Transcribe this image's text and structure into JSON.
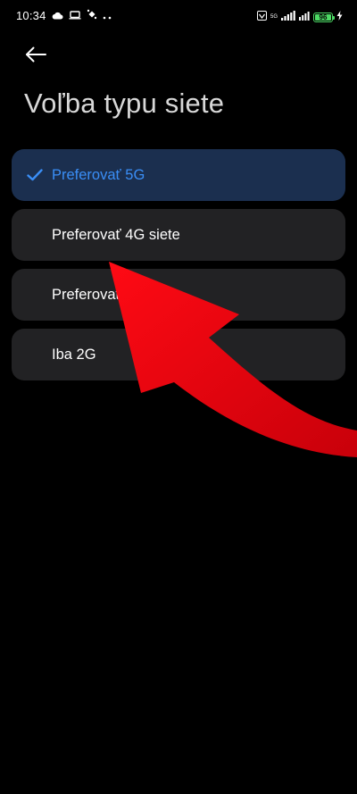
{
  "status_bar": {
    "time": "10:34",
    "network": "5G",
    "battery_level": "96"
  },
  "header": {
    "back_icon": "arrow-left-icon",
    "title": "Voľba typu siete"
  },
  "options": [
    {
      "label": "Preferovať 5G",
      "selected": true
    },
    {
      "label": "Preferovať 4G siete",
      "selected": false
    },
    {
      "label": "Preferovať 3G",
      "selected": false
    },
    {
      "label": "Iba 2G",
      "selected": false
    }
  ],
  "colors": {
    "background": "#000000",
    "option_background": "#222224",
    "selected_background": "#1b2f4f",
    "accent": "#3a8ef6",
    "battery": "#4cd964",
    "overlay_arrow": "#e8000c"
  }
}
